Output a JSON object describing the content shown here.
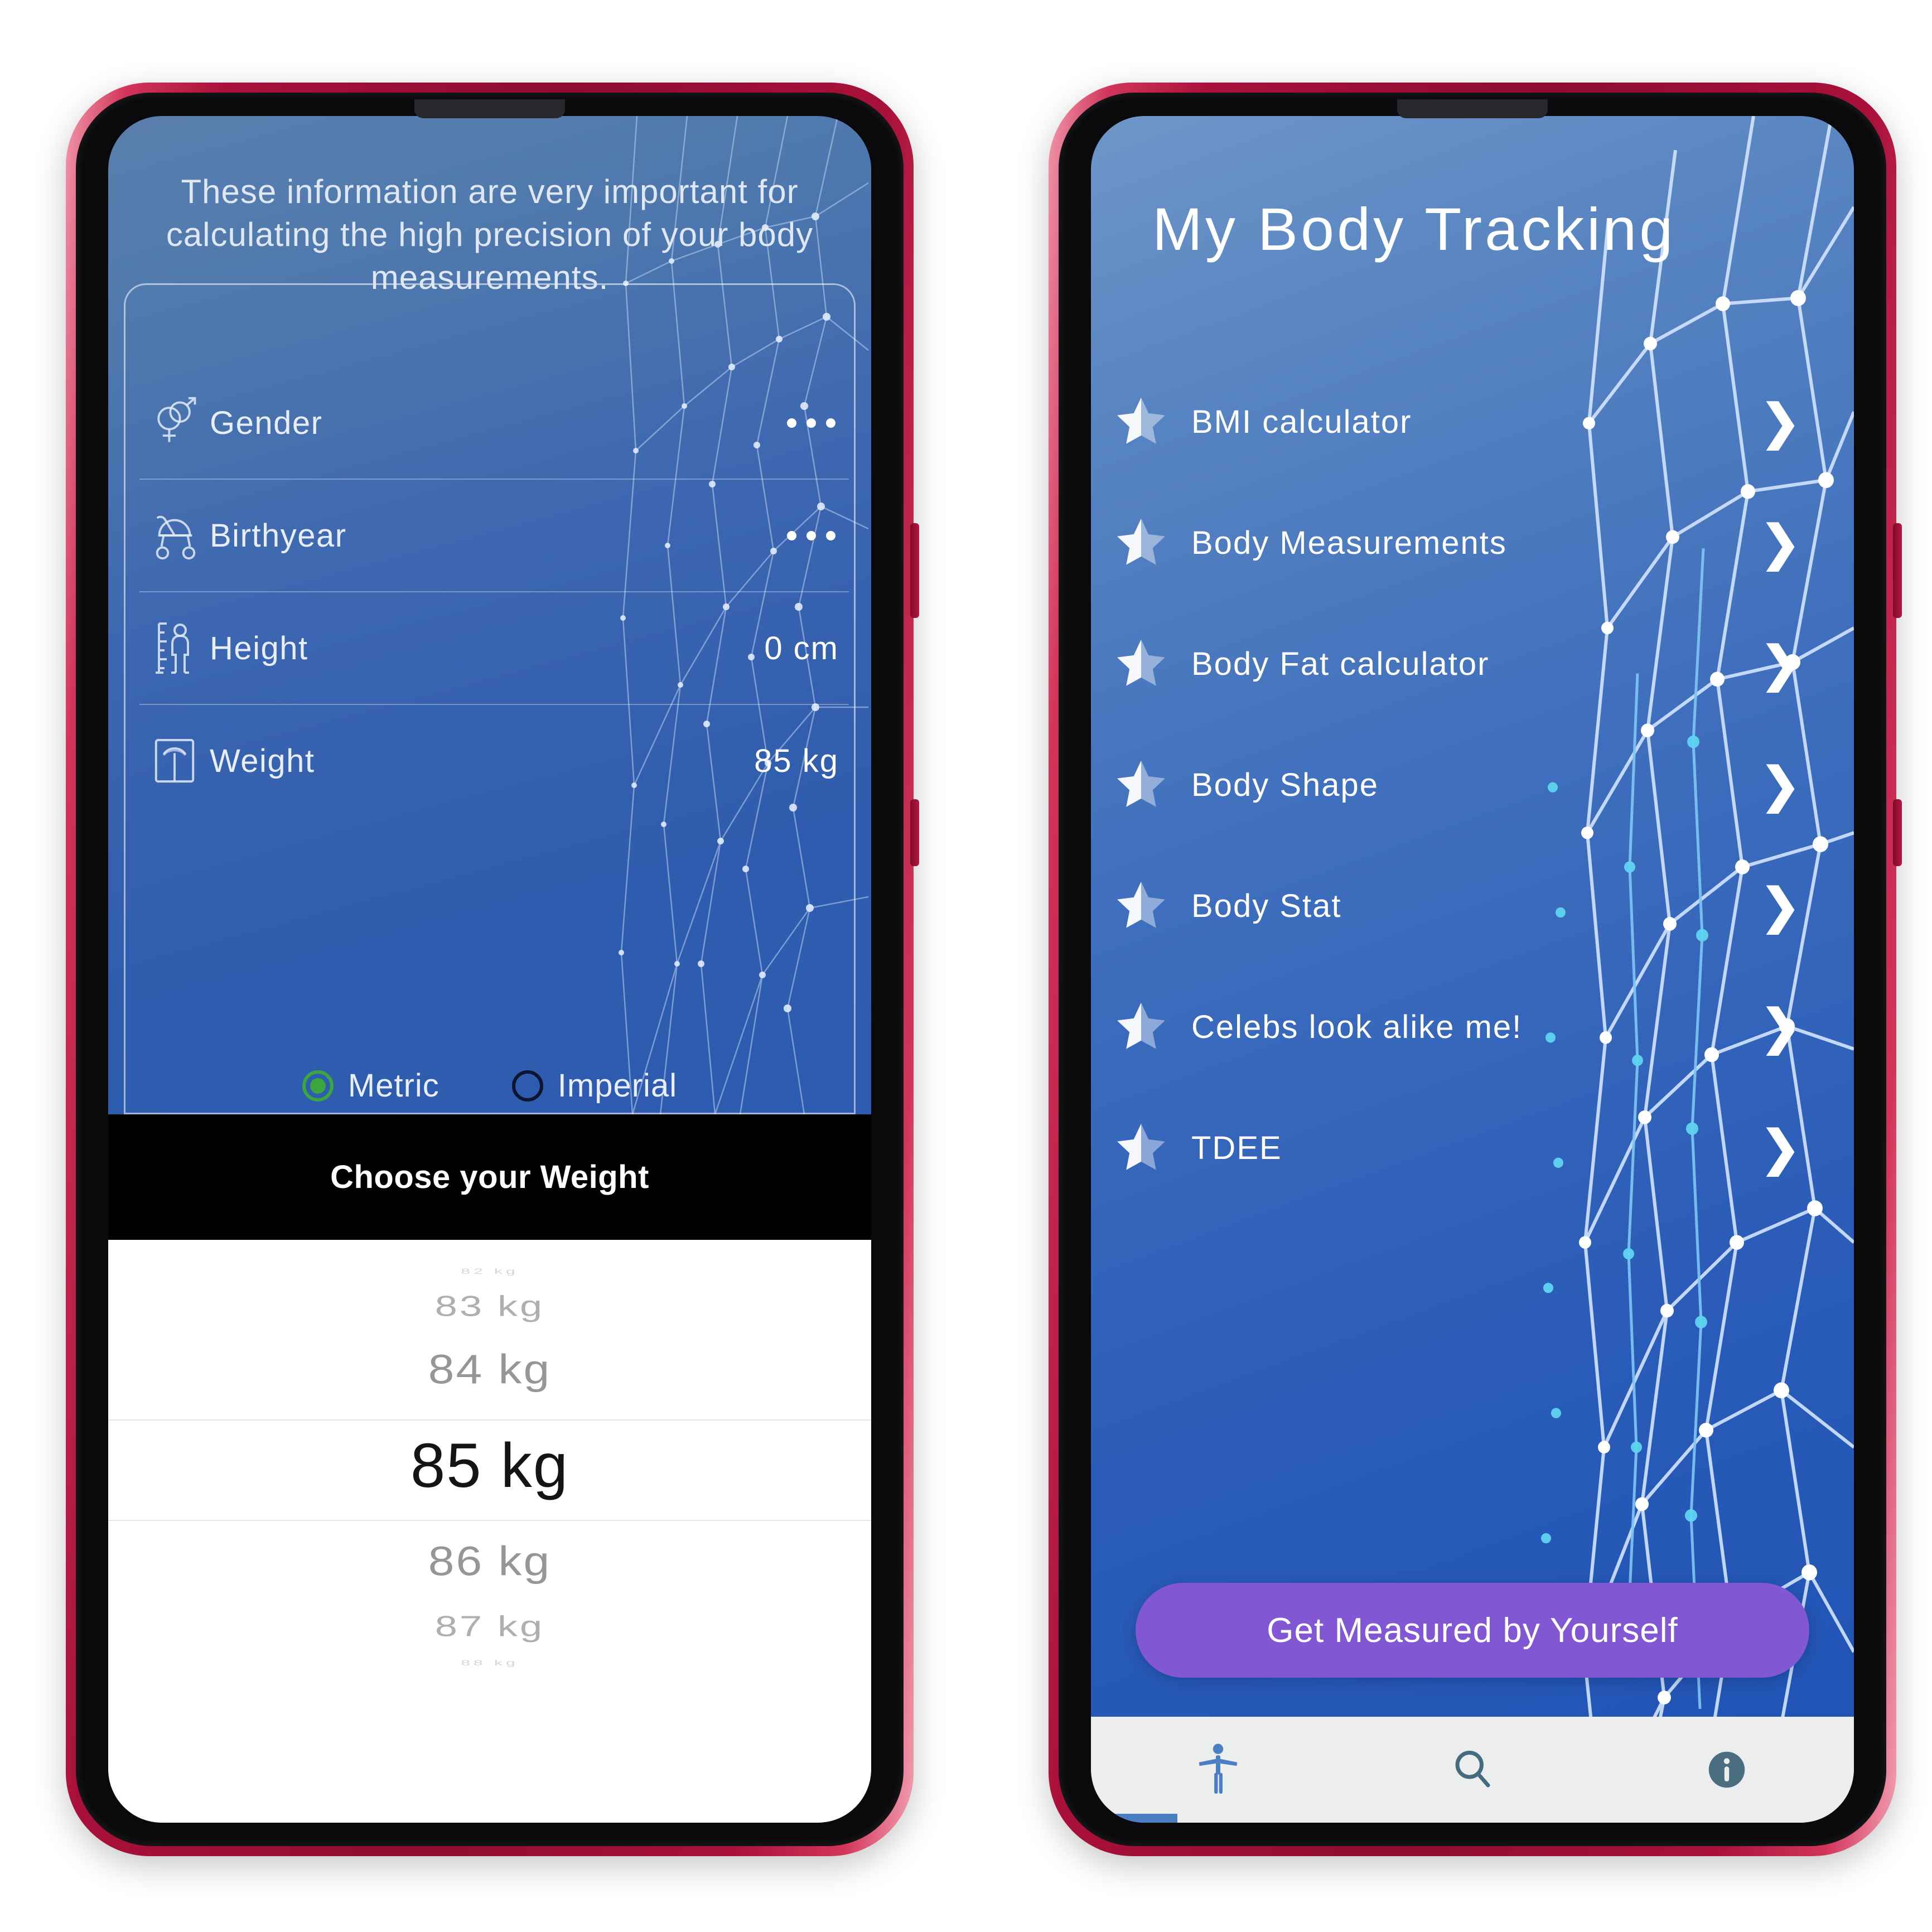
{
  "app": {
    "name": "My Body Tracking",
    "accent_blue": "#2f5cae",
    "accent_purple": "#8157d4",
    "radio_green": "#3da53d",
    "frame_color": "#a8103a"
  },
  "left_phone": {
    "screen_name": "body-data-entry",
    "lead_text": "These information are very important for calculating the high precision of your body measurements.",
    "form_rows": [
      {
        "icon": "gender-icon",
        "label": "Gender",
        "value": "",
        "value_kind": "ellipsis"
      },
      {
        "icon": "stroller-icon",
        "label": "Birthyear",
        "value": "",
        "value_kind": "ellipsis"
      },
      {
        "icon": "height-icon",
        "label": "Height",
        "value": "0 cm",
        "value_kind": "text"
      },
      {
        "icon": "scale-icon",
        "label": "Weight",
        "value": "85 kg",
        "value_kind": "text"
      }
    ],
    "units": {
      "selected": "Metric",
      "options": [
        {
          "label": "Metric",
          "selected": true
        },
        {
          "label": "Imperial",
          "selected": false
        }
      ]
    },
    "picker": {
      "title": "Choose your Weight",
      "selected_value": "85 kg",
      "items": [
        {
          "label": "82 kg",
          "state": "far"
        },
        {
          "label": "83 kg",
          "state": "near"
        },
        {
          "label": "84 kg",
          "state": "adjacent"
        },
        {
          "label": "85 kg",
          "state": "selected"
        },
        {
          "label": "86 kg",
          "state": "adjacent"
        },
        {
          "label": "87 kg",
          "state": "near"
        },
        {
          "label": "88 kg",
          "state": "far"
        }
      ]
    }
  },
  "right_phone": {
    "screen_name": "home-menu",
    "title": "My Body Tracking",
    "menu_items": [
      {
        "label": "BMI calculator",
        "star": "half-star-icon",
        "chevron": "chevron-right-icon"
      },
      {
        "label": "Body Measurements",
        "star": "half-star-icon",
        "chevron": "chevron-right-icon"
      },
      {
        "label": "Body Fat calculator",
        "star": "half-star-icon",
        "chevron": "chevron-right-icon"
      },
      {
        "label": "Body Shape",
        "star": "half-star-icon",
        "chevron": "chevron-right-icon"
      },
      {
        "label": "Body Stat",
        "star": "half-star-icon",
        "chevron": "chevron-right-icon"
      },
      {
        "label": "Celebs look alike me!",
        "star": "half-star-icon",
        "chevron": "chevron-right-icon"
      },
      {
        "label": "TDEE",
        "star": "half-star-icon",
        "chevron": "chevron-right-icon"
      }
    ],
    "cta_label": "Get Measured by Yourself",
    "bottom_nav": [
      {
        "icon": "body-person-icon",
        "active": true
      },
      {
        "icon": "search-icon",
        "active": false
      },
      {
        "icon": "info-icon",
        "active": false
      }
    ]
  }
}
